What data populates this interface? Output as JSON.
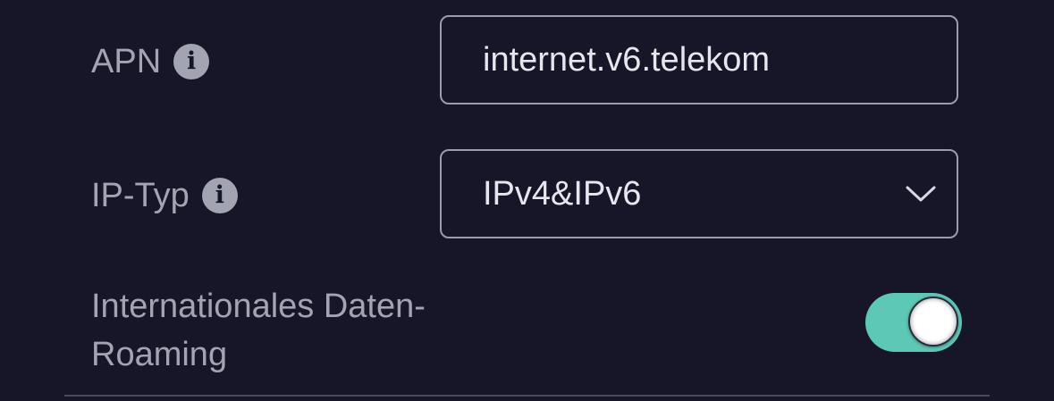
{
  "apn": {
    "label": "APN",
    "info_icon": "info-icon",
    "value": "internet.v6.telekom"
  },
  "ip_type": {
    "label": "IP-Typ",
    "info_icon": "info-icon",
    "selected": "IPv4&IPv6",
    "chevron_icon": "chevron-down-icon"
  },
  "roaming": {
    "label": "Internationales Daten-Roaming",
    "enabled": true
  },
  "colors": {
    "background": "#161628",
    "label": "#a3a4b2",
    "value": "#e6e6ee",
    "border": "#9b9bab",
    "toggle_on": "#5cc8b5"
  },
  "icon_glyphs": {
    "info": "i"
  }
}
